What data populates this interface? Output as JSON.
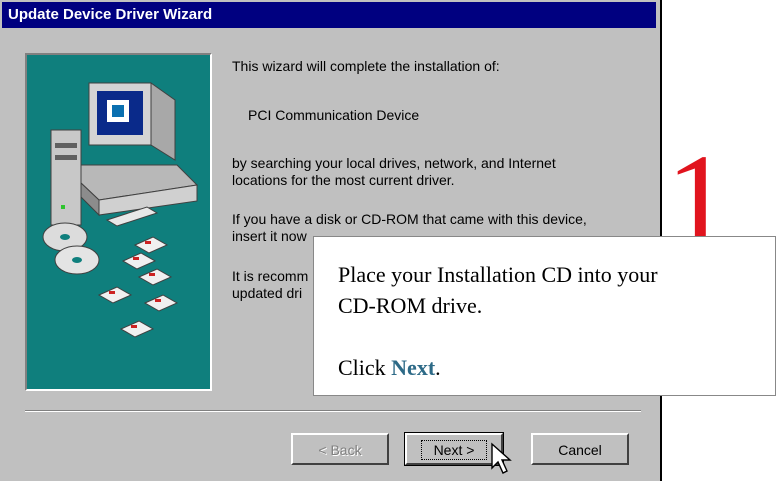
{
  "window": {
    "title": "Update Device Driver Wizard"
  },
  "content": {
    "intro": "This wizard will complete the installation of:",
    "device": "PCI Communication Device",
    "search_text_1": "by searching your local drives, network, and Internet",
    "search_text_2": "locations for the most current driver.",
    "disk_text_1": "If you have a disk or CD-ROM that came with this device,",
    "disk_text_2": "insert it now",
    "recommend_1": "It is recomm",
    "recommend_2": "updated dri"
  },
  "buttons": {
    "back": "< Back",
    "next": "Next >",
    "cancel": "Cancel"
  },
  "callout": {
    "line1": "Place your Installation CD into your",
    "line2": "CD-ROM drive.",
    "click": "Click ",
    "next": "Next",
    "period": "."
  },
  "step": "1",
  "colors": {
    "titlebar": "#000080",
    "art_bg": "#0f7f7d",
    "step_red": "#e1141e",
    "next_blue": "#2d6a87"
  }
}
